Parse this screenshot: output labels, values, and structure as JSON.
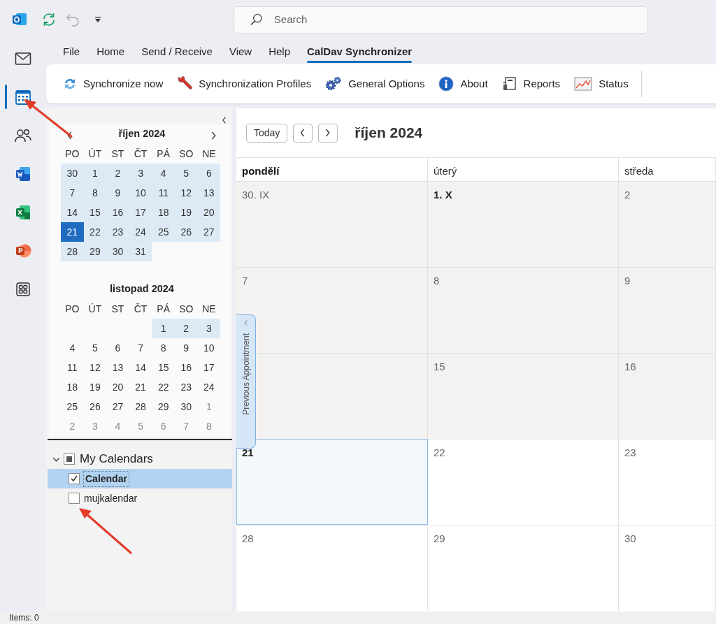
{
  "app_bar": {
    "logo": {
      "kind": "outlook"
    },
    "quick_access": [
      {
        "kind": "sync",
        "disabled": false
      },
      {
        "kind": "undo",
        "disabled": true
      },
      {
        "kind": "customize",
        "disabled": false
      }
    ],
    "search": {
      "placeholder": "Search"
    }
  },
  "rail": [
    {
      "kind": "mail",
      "selected": false
    },
    {
      "kind": "calendar",
      "selected": true
    },
    {
      "kind": "people",
      "selected": false
    },
    {
      "kind": "word",
      "selected": false
    },
    {
      "kind": "excel",
      "selected": false
    },
    {
      "kind": "powerpoint",
      "selected": false
    },
    {
      "kind": "apps",
      "selected": false
    }
  ],
  "ribbon_tabs": [
    {
      "label": "File",
      "selected": false
    },
    {
      "label": "Home",
      "selected": false
    },
    {
      "label": "Send / Receive",
      "selected": false
    },
    {
      "label": "View",
      "selected": false
    },
    {
      "label": "Help",
      "selected": false
    },
    {
      "label": "CalDav Synchronizer",
      "selected": true
    }
  ],
  "ribbon_buttons": [
    {
      "kind": "sync",
      "label": "Synchronize now"
    },
    {
      "kind": "wrench",
      "label": "Synchronization Profiles"
    },
    {
      "kind": "gears",
      "label": "General Options"
    },
    {
      "kind": "info",
      "label": "About"
    },
    {
      "kind": "report",
      "label": "Reports"
    },
    {
      "kind": "chart",
      "label": "Status"
    }
  ],
  "mini_calendars": [
    {
      "title": "říjen 2024",
      "weekdays": [
        "PO",
        "ÚT",
        "ST",
        "ČT",
        "PÁ",
        "SO",
        "NE"
      ],
      "weeks": [
        [
          {
            "day": "30",
            "highlight": true,
            "selected": false,
            "muted": false
          },
          {
            "day": "1",
            "highlight": true,
            "selected": false,
            "muted": false
          },
          {
            "day": "2",
            "highlight": true,
            "selected": false,
            "muted": false
          },
          {
            "day": "3",
            "highlight": true,
            "selected": false,
            "muted": false
          },
          {
            "day": "4",
            "highlight": true,
            "selected": false,
            "muted": false
          },
          {
            "day": "5",
            "highlight": true,
            "selected": false,
            "muted": false
          },
          {
            "day": "6",
            "highlight": true,
            "selected": false,
            "muted": false
          }
        ],
        [
          {
            "day": "7",
            "highlight": true,
            "selected": false,
            "muted": false
          },
          {
            "day": "8",
            "highlight": true,
            "selected": false,
            "muted": false
          },
          {
            "day": "9",
            "highlight": true,
            "selected": false,
            "muted": false
          },
          {
            "day": "10",
            "highlight": true,
            "selected": false,
            "muted": false
          },
          {
            "day": "11",
            "highlight": true,
            "selected": false,
            "muted": false
          },
          {
            "day": "12",
            "highlight": true,
            "selected": false,
            "muted": false
          },
          {
            "day": "13",
            "highlight": true,
            "selected": false,
            "muted": false
          }
        ],
        [
          {
            "day": "14",
            "highlight": true,
            "selected": false,
            "muted": false
          },
          {
            "day": "15",
            "highlight": true,
            "selected": false,
            "muted": false
          },
          {
            "day": "16",
            "highlight": true,
            "selected": false,
            "muted": false
          },
          {
            "day": "17",
            "highlight": true,
            "selected": false,
            "muted": false
          },
          {
            "day": "18",
            "highlight": true,
            "selected": false,
            "muted": false
          },
          {
            "day": "19",
            "highlight": true,
            "selected": false,
            "muted": false
          },
          {
            "day": "20",
            "highlight": true,
            "selected": false,
            "muted": false
          }
        ],
        [
          {
            "day": "21",
            "highlight": true,
            "selected": true,
            "muted": false
          },
          {
            "day": "22",
            "highlight": true,
            "selected": false,
            "muted": false
          },
          {
            "day": "23",
            "highlight": true,
            "selected": false,
            "muted": false
          },
          {
            "day": "24",
            "highlight": true,
            "selected": false,
            "muted": false
          },
          {
            "day": "25",
            "highlight": true,
            "selected": false,
            "muted": false
          },
          {
            "day": "26",
            "highlight": true,
            "selected": false,
            "muted": false
          },
          {
            "day": "27",
            "highlight": true,
            "selected": false,
            "muted": false
          }
        ],
        [
          {
            "day": "28",
            "highlight": true,
            "selected": false,
            "muted": false
          },
          {
            "day": "29",
            "highlight": true,
            "selected": false,
            "muted": false
          },
          {
            "day": "30",
            "highlight": true,
            "selected": false,
            "muted": false
          },
          {
            "day": "31",
            "highlight": true,
            "selected": false,
            "muted": false
          }
        ]
      ]
    },
    {
      "title": "listopad 2024",
      "weekdays": [
        "PO",
        "ÚT",
        "ST",
        "ČT",
        "PÁ",
        "SO",
        "NE"
      ],
      "weeks": [
        {
          "kind": "tail",
          "days": [
            {
              "day": "1",
              "highlight": true,
              "selected": false,
              "muted": false
            },
            {
              "day": "2",
              "highlight": true,
              "selected": false,
              "muted": false
            },
            {
              "day": "3",
              "highlight": true,
              "selected": false,
              "muted": false
            }
          ]
        },
        [
          {
            "day": "4",
            "highlight": false,
            "selected": false,
            "muted": false
          },
          {
            "day": "5",
            "highlight": false,
            "selected": false,
            "muted": false
          },
          {
            "day": "6",
            "highlight": false,
            "selected": false,
            "muted": false
          },
          {
            "day": "7",
            "highlight": false,
            "selected": false,
            "muted": false
          },
          {
            "day": "8",
            "highlight": false,
            "selected": false,
            "muted": false
          },
          {
            "day": "9",
            "highlight": false,
            "selected": false,
            "muted": false
          },
          {
            "day": "10",
            "highlight": false,
            "selected": false,
            "muted": false
          }
        ],
        [
          {
            "day": "11",
            "highlight": false,
            "selected": false,
            "muted": false
          },
          {
            "day": "12",
            "highlight": false,
            "selected": false,
            "muted": false
          },
          {
            "day": "13",
            "highlight": false,
            "selected": false,
            "muted": false
          },
          {
            "day": "14",
            "highlight": false,
            "selected": false,
            "muted": false
          },
          {
            "day": "15",
            "highlight": false,
            "selected": false,
            "muted": false
          },
          {
            "day": "16",
            "highlight": false,
            "selected": false,
            "muted": false
          },
          {
            "day": "17",
            "highlight": false,
            "selected": false,
            "muted": false
          }
        ],
        [
          {
            "day": "18",
            "highlight": false,
            "selected": false,
            "muted": false
          },
          {
            "day": "19",
            "highlight": false,
            "selected": false,
            "muted": false
          },
          {
            "day": "20",
            "highlight": false,
            "selected": false,
            "muted": false
          },
          {
            "day": "21",
            "highlight": false,
            "selected": false,
            "muted": false
          },
          {
            "day": "22",
            "highlight": false,
            "selected": false,
            "muted": false
          },
          {
            "day": "23",
            "highlight": false,
            "selected": false,
            "muted": false
          },
          {
            "day": "24",
            "highlight": false,
            "selected": false,
            "muted": false
          }
        ],
        [
          {
            "day": "25",
            "highlight": false,
            "selected": false,
            "muted": false
          },
          {
            "day": "26",
            "highlight": false,
            "selected": false,
            "muted": false
          },
          {
            "day": "27",
            "highlight": false,
            "selected": false,
            "muted": false
          },
          {
            "day": "28",
            "highlight": false,
            "selected": false,
            "muted": false
          },
          {
            "day": "29",
            "highlight": false,
            "selected": false,
            "muted": false
          },
          {
            "day": "30",
            "highlight": false,
            "selected": false,
            "muted": false
          },
          {
            "day": "1",
            "highlight": false,
            "selected": false,
            "muted": true
          }
        ],
        [
          {
            "day": "2",
            "highlight": false,
            "selected": false,
            "muted": true
          },
          {
            "day": "3",
            "highlight": false,
            "selected": false,
            "muted": true
          },
          {
            "day": "4",
            "highlight": false,
            "selected": false,
            "muted": true
          },
          {
            "day": "5",
            "highlight": false,
            "selected": false,
            "muted": true
          },
          {
            "day": "6",
            "highlight": false,
            "selected": false,
            "muted": true
          },
          {
            "day": "7",
            "highlight": false,
            "selected": false,
            "muted": true
          },
          {
            "day": "8",
            "highlight": false,
            "selected": false,
            "muted": true
          }
        ]
      ]
    }
  ],
  "calendar_tree": {
    "label": "My Calendars",
    "expanded": true,
    "indeterminate": true,
    "children": [
      {
        "label": "Calendar",
        "checked": true,
        "selected": true
      },
      {
        "label": "mujkalendar",
        "checked": false,
        "selected": false
      }
    ]
  },
  "month_view": {
    "today_button": "Today",
    "title": "říjen 2024",
    "side_tab": "Previous Appointment",
    "columns": [
      {
        "label": "pondělí",
        "bold": true
      },
      {
        "label": "úterý",
        "bold": false
      },
      {
        "label": "středa",
        "bold": false
      }
    ],
    "weeks": [
      [
        {
          "label": "30. IX",
          "bold": false,
          "shaded": true,
          "selected": false
        },
        {
          "label": "1. X",
          "bold": true,
          "shaded": true,
          "selected": false
        },
        {
          "label": "2",
          "bold": false,
          "shaded": true,
          "selected": false
        }
      ],
      [
        {
          "label": "7",
          "bold": false,
          "shaded": true,
          "selected": false
        },
        {
          "label": "8",
          "bold": false,
          "shaded": true,
          "selected": false
        },
        {
          "label": "9",
          "bold": false,
          "shaded": true,
          "selected": false
        }
      ],
      [
        {
          "shaded": true,
          "selected": false
        },
        {
          "label": "15",
          "bold": false,
          "shaded": true,
          "selected": false
        },
        {
          "label": "16",
          "bold": false,
          "shaded": true,
          "selected": false
        }
      ],
      [
        {
          "label": "21",
          "bold": true,
          "shaded": false,
          "selected": true
        },
        {
          "label": "22",
          "bold": false,
          "shaded": false,
          "selected": false
        },
        {
          "label": "23",
          "bold": false,
          "shaded": false,
          "selected": false
        }
      ],
      [
        {
          "label": "28",
          "bold": false,
          "shaded": false,
          "selected": false
        },
        {
          "label": "29",
          "bold": false,
          "shaded": false,
          "selected": false
        },
        {
          "label": "30",
          "bold": false,
          "shaded": false,
          "selected": false
        }
      ]
    ]
  },
  "status_bar": {
    "text": "Items: 0"
  }
}
